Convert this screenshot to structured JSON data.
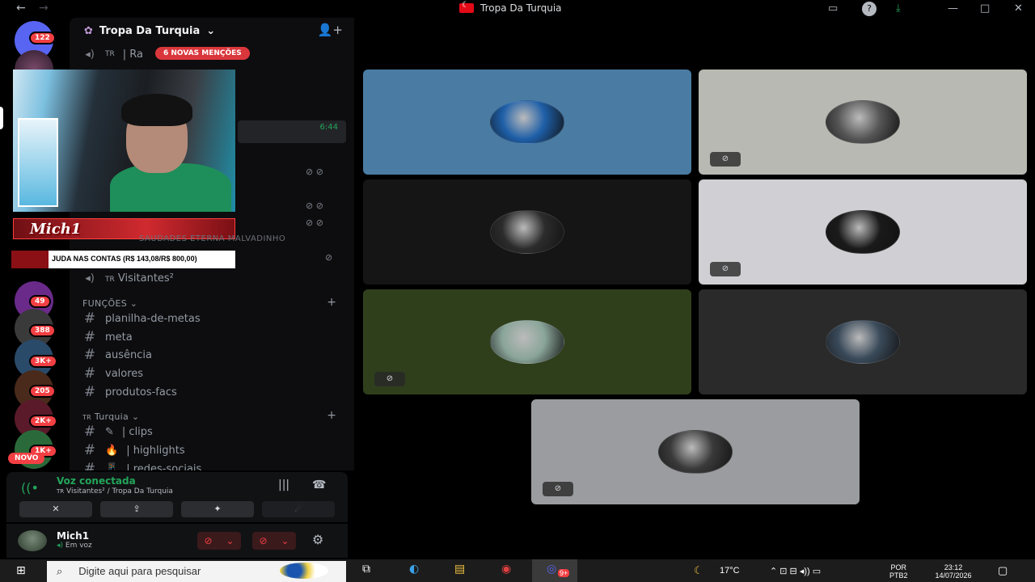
{
  "window": {
    "title": "Tropa Da Turquia",
    "back_icon": "←",
    "forward_icon": "→",
    "inbox_icon": "▭",
    "help_icon": "?",
    "download_icon": "⤓",
    "minimize_icon": "—",
    "maximize_icon": "□",
    "close_icon": "✕"
  },
  "rail": {
    "badges": [
      "122",
      "49",
      "388",
      "3K+",
      "205",
      "2K+",
      "1K+"
    ],
    "novo_label": "NOVO"
  },
  "server": {
    "name": "Tropa Da Turquia",
    "chevron": "⌄",
    "invite_icon": "👤+",
    "mentions_banner": "6 NOVAS MENÇÕES",
    "first_channel_prefix": "TR",
    "first_channel_label": "| Ra",
    "timer": "6:44",
    "hidden_channel_text": "SAUDADES ETERNA MALVADINHO",
    "visitors_channel": "Visitantes²",
    "visitors_prefix": "TR"
  },
  "categories": [
    {
      "name": "FUNÇÕES",
      "chevron": "⌄",
      "channels": [
        "planilha-de-metas",
        "meta",
        "ausência",
        "valores",
        "produtos-facs"
      ]
    },
    {
      "prefix": "TR",
      "name": "Turquia",
      "chevron": "⌄",
      "channels": [
        {
          "emoji": "✎",
          "name": "| clips"
        },
        {
          "emoji": "🔥",
          "name": "| highlights"
        },
        {
          "emoji": "📱",
          "name": "| redes-sociais"
        }
      ]
    }
  ],
  "overlay": {
    "streamer_name": "Mich1",
    "donation_text": "JUDA NAS CONTAS (R$ 143,08/R$ 800,00)"
  },
  "voice": {
    "status": "Voz conectada",
    "channel_prefix": "TR",
    "channel": "Visitantes² / Tropa Da Turquia",
    "signal_icon": "((•",
    "soundboard_icon": "|||",
    "disconnect_icon": "☎",
    "buttons": [
      "✕",
      "⇪",
      "✦",
      "☄"
    ]
  },
  "user": {
    "name": "Mich1",
    "status": "Em voz",
    "status_icon": "◂)",
    "mic_icon": "⊘",
    "headset_icon": "⊘",
    "caret": "⌄",
    "settings_icon": "⚙"
  },
  "tiles": [
    {
      "bg": "#4a7ca3",
      "avatar": "#1e5fa8",
      "flag": false
    },
    {
      "bg": "#b9b9b3",
      "avatar": "#555555",
      "flag": true,
      "flag_icon": "⊘"
    },
    {
      "bg": "#151515",
      "avatar": "#2c2c2c",
      "flag": false
    },
    {
      "bg": "#cfcfd4",
      "avatar": "#1a1a1a",
      "flag": true,
      "flag_icon": "⊘"
    },
    {
      "bg": "#2f3f1c",
      "avatar": "#8aa59a",
      "flag": true,
      "flag_icon": "⊘"
    },
    {
      "bg": "#2a2a2a",
      "avatar": "#3a4a5a",
      "flag": false
    },
    {
      "bg": "#9a9c9f",
      "avatar": "#3a3a3a",
      "flag": true,
      "flag_icon": "⊘"
    }
  ],
  "taskbar": {
    "search_icon": "⌕",
    "search_placeholder": "Digite aqui para pesquisar",
    "start_icon": "⊞",
    "weather_icon": "☾",
    "temperature": "17°C",
    "lang_line1": "POR",
    "lang_line2": "PTB2",
    "time": "23:12",
    "date": "14/07/2026",
    "notifications_icon": "▢",
    "tray_icons": "⌃  ⊡  ⊟  ◂))  ▭",
    "apps": [
      "⧉",
      "◐",
      "▤",
      "◉",
      "◎"
    ],
    "app_badge": "9+"
  }
}
